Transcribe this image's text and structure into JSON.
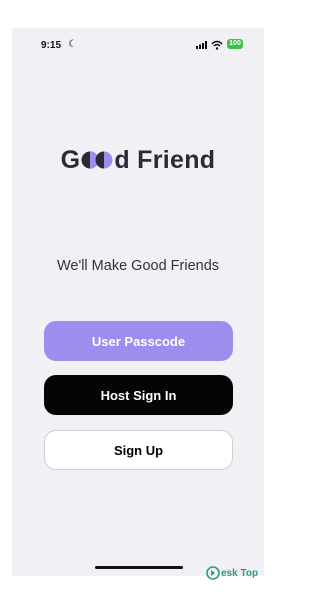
{
  "status_bar": {
    "time": "9:15",
    "battery": "100",
    "icons": [
      "moon-icon",
      "signal-icon",
      "wifi-icon",
      "battery-icon"
    ],
    "battery_color": "#3ac34a"
  },
  "app": {
    "logo_prefix": "G",
    "logo_suffix": "d Friend",
    "tagline": "We'll Make Good Friends",
    "accent_color": "#9b8eee"
  },
  "buttons": {
    "passcode_label": "User Passcode",
    "host_label": "Host Sign In",
    "signup_label": "Sign Up"
  },
  "watermark": {
    "text": "esk Top"
  }
}
